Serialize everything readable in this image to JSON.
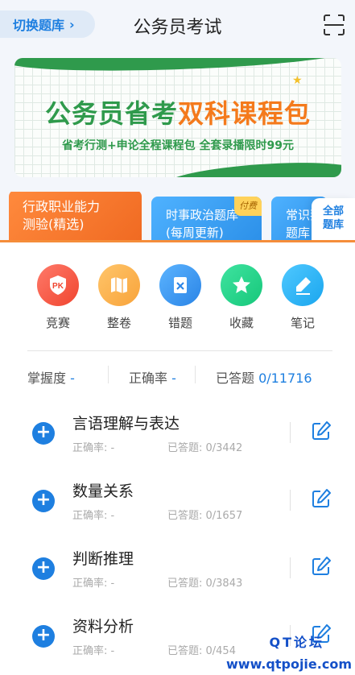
{
  "header": {
    "switch_label": "切换题库",
    "title": "公务员考试"
  },
  "banner": {
    "title_green": "公务员省考",
    "title_orange": "双科课程包",
    "subtitle": "省考行测+申论全程课程包 全套录播限时99元"
  },
  "categories": [
    {
      "line1": "行政职业能力",
      "line2": "测验(精选)"
    },
    {
      "line1": "时事政治题库",
      "line2": "(每周更新)",
      "badge": "付费"
    },
    {
      "line1": "常识判",
      "line2": "题库"
    }
  ],
  "all_label_1": "全部",
  "all_label_2": "题库",
  "functions": [
    {
      "label": "竞赛",
      "icon": "pk-shield-icon"
    },
    {
      "label": "整卷",
      "icon": "map-icon"
    },
    {
      "label": "错题",
      "icon": "wrong-note-icon"
    },
    {
      "label": "收藏",
      "icon": "star-icon"
    },
    {
      "label": "笔记",
      "icon": "pen-icon"
    }
  ],
  "stats": {
    "mastery_label": "掌握度",
    "mastery_value": "-",
    "accuracy_label": "正确率",
    "accuracy_value": "-",
    "answered_label": "已答题",
    "answered_value": "0/11716"
  },
  "subjects": [
    {
      "name": "言语理解与表达",
      "accuracy": "正确率: -",
      "answered": "已答题: 0/3442"
    },
    {
      "name": "数量关系",
      "accuracy": "正确率: -",
      "answered": "已答题: 0/1657"
    },
    {
      "name": "判断推理",
      "accuracy": "正确率: -",
      "answered": "已答题: 0/3843"
    },
    {
      "name": "资料分析",
      "accuracy": "正确率: -",
      "answered": "已答题: 0/454"
    }
  ],
  "watermark": {
    "line1": "QT论坛",
    "line2": "www.qtpojie.com"
  },
  "colors": {
    "accent": "#1e7fe0",
    "orange": "#f58d3a",
    "green": "#2f9a4c"
  }
}
